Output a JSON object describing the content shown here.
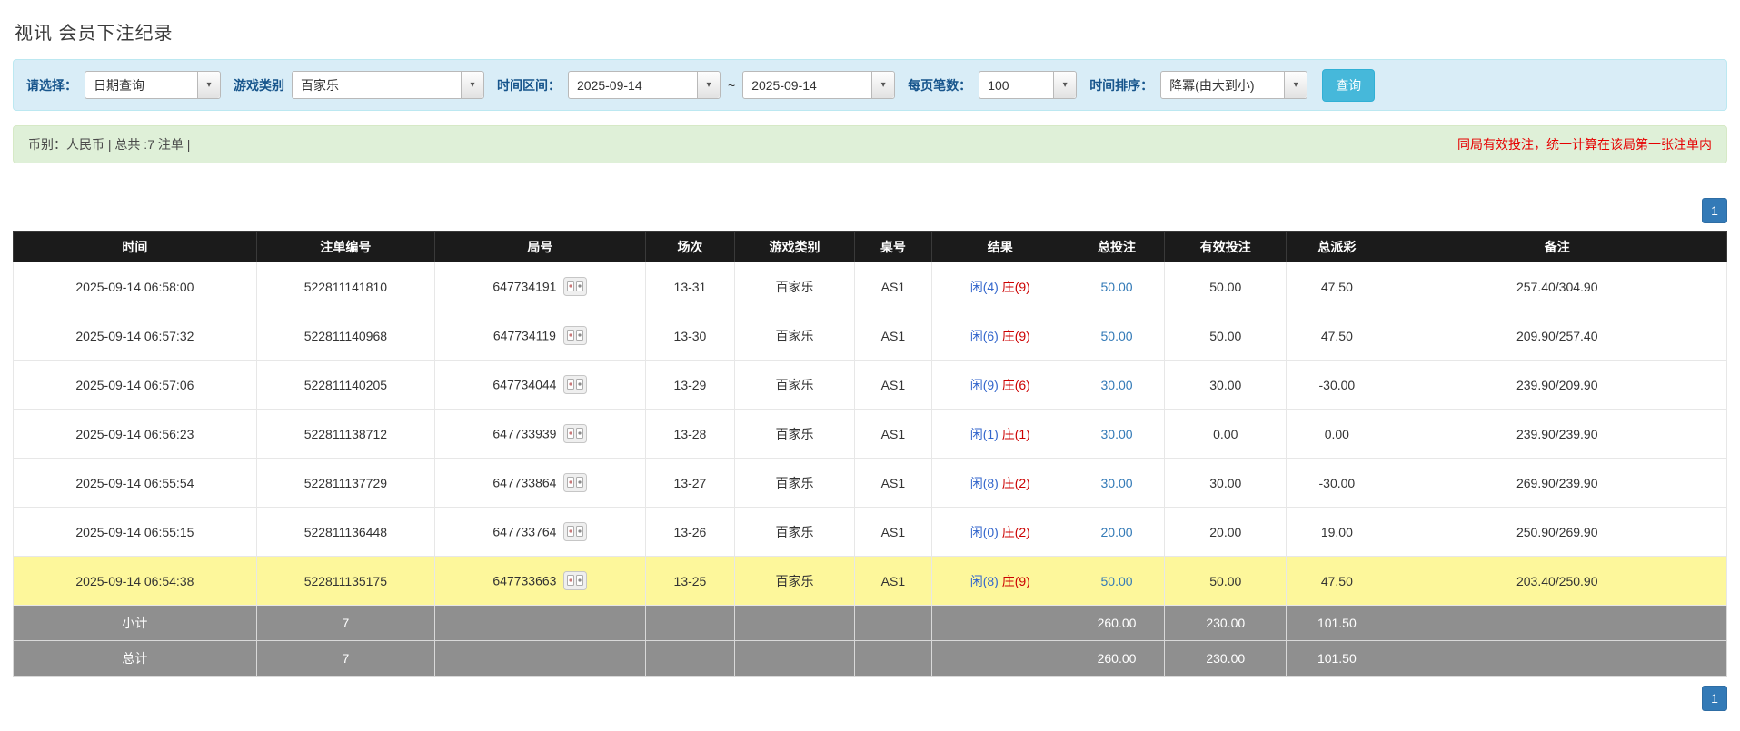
{
  "page": {
    "title": "视讯 会员下注纪录"
  },
  "filters": {
    "select_label": "请选择：",
    "select_value": "日期查询",
    "game_type_label": "游戏类别",
    "game_type_value": "百家乐",
    "date_range_label": "时间区间：",
    "date_from": "2025-09-14",
    "date_to": "2025-09-14",
    "range_separator": "~",
    "page_size_label": "每页笔数：",
    "page_size_value": "100",
    "sort_label": "时间排序：",
    "sort_value": "降冪(由大到小)",
    "search_button": "查询"
  },
  "summary": {
    "left": "币别：人民币 | 总共 :7 注单 |",
    "right": "同局有效投注，统一计算在该局第一张注单内"
  },
  "pagination": {
    "page": "1"
  },
  "table": {
    "headers": [
      "时间",
      "注单编号",
      "局号",
      "场次",
      "游戏类别",
      "桌号",
      "结果",
      "总投注",
      "有效投注",
      "总派彩",
      "备注"
    ],
    "rows": [
      {
        "time": "2025-09-14 06:58:00",
        "bet_id": "522811141810",
        "round": "647734191",
        "session": "13-31",
        "game": "百家乐",
        "table_no": "AS1",
        "result_player": "闲(4)",
        "result_banker": "庄(9)",
        "total_bet": "50.00",
        "valid_bet": "50.00",
        "payout": "47.50",
        "note": "257.40/304.90",
        "highlight": false
      },
      {
        "time": "2025-09-14 06:57:32",
        "bet_id": "522811140968",
        "round": "647734119",
        "session": "13-30",
        "game": "百家乐",
        "table_no": "AS1",
        "result_player": "闲(6)",
        "result_banker": "庄(9)",
        "total_bet": "50.00",
        "valid_bet": "50.00",
        "payout": "47.50",
        "note": "209.90/257.40",
        "highlight": false
      },
      {
        "time": "2025-09-14 06:57:06",
        "bet_id": "522811140205",
        "round": "647734044",
        "session": "13-29",
        "game": "百家乐",
        "table_no": "AS1",
        "result_player": "闲(9)",
        "result_banker": "庄(6)",
        "total_bet": "30.00",
        "valid_bet": "30.00",
        "payout": "-30.00",
        "note": "239.90/209.90",
        "highlight": false
      },
      {
        "time": "2025-09-14 06:56:23",
        "bet_id": "522811138712",
        "round": "647733939",
        "session": "13-28",
        "game": "百家乐",
        "table_no": "AS1",
        "result_player": "闲(1)",
        "result_banker": "庄(1)",
        "total_bet": "30.00",
        "valid_bet": "0.00",
        "payout": "0.00",
        "note": "239.90/239.90",
        "highlight": false
      },
      {
        "time": "2025-09-14 06:55:54",
        "bet_id": "522811137729",
        "round": "647733864",
        "session": "13-27",
        "game": "百家乐",
        "table_no": "AS1",
        "result_player": "闲(8)",
        "result_banker": "庄(2)",
        "total_bet": "30.00",
        "valid_bet": "30.00",
        "payout": "-30.00",
        "note": "269.90/239.90",
        "highlight": false
      },
      {
        "time": "2025-09-14 06:55:15",
        "bet_id": "522811136448",
        "round": "647733764",
        "session": "13-26",
        "game": "百家乐",
        "table_no": "AS1",
        "result_player": "闲(0)",
        "result_banker": "庄(2)",
        "total_bet": "20.00",
        "valid_bet": "20.00",
        "payout": "19.00",
        "note": "250.90/269.90",
        "highlight": false
      },
      {
        "time": "2025-09-14 06:54:38",
        "bet_id": "522811135175",
        "round": "647733663",
        "session": "13-25",
        "game": "百家乐",
        "table_no": "AS1",
        "result_player": "闲(8)",
        "result_banker": "庄(9)",
        "total_bet": "50.00",
        "valid_bet": "50.00",
        "payout": "47.50",
        "note": "203.40/250.90",
        "highlight": true
      }
    ],
    "subtotal": {
      "label": "小计",
      "count": "7",
      "total_bet": "260.00",
      "valid_bet": "230.00",
      "payout": "101.50"
    },
    "total": {
      "label": "总计",
      "count": "7",
      "total_bet": "260.00",
      "valid_bet": "230.00",
      "payout": "101.50"
    }
  },
  "colors": {
    "filter_bar_bg": "#d9edf7",
    "summary_bar_bg": "#dff0d8",
    "table_header_bg": "#1b1b1b",
    "highlight_row": "#fdf79b",
    "footer_row_bg": "#8f8f8f",
    "link_blue": "#337ab7",
    "negative_red": "#dd0000",
    "player_blue": "#3366cc",
    "banker_red": "#cc0000",
    "search_button_bg": "#46b8da",
    "note_red": "#e60000",
    "pager_blue": "#337ab7"
  }
}
